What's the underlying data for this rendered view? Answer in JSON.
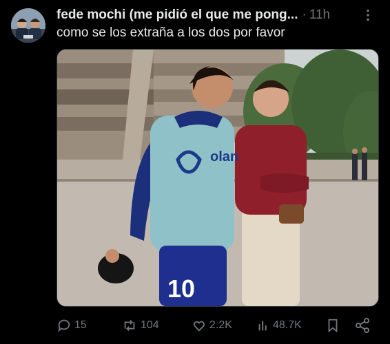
{
  "tweet": {
    "display_name": "fede mochi (me pidió el que me pong...",
    "separator": "·",
    "timestamp": "11h",
    "text": "como se los extraña a los dos por favor",
    "media": {
      "jersey_number": "10",
      "shirt_logo": "olan"
    },
    "actions": {
      "replies": "15",
      "reposts": "104",
      "likes": "2.2K",
      "views": "48.7K"
    }
  },
  "colors": {
    "background": "#000000",
    "primary_text": "#e7e9ea",
    "secondary_text": "#71767b"
  },
  "icons": [
    "more-icon",
    "reply-icon",
    "repost-icon",
    "like-icon",
    "views-icon",
    "bookmark-icon",
    "share-icon"
  ]
}
